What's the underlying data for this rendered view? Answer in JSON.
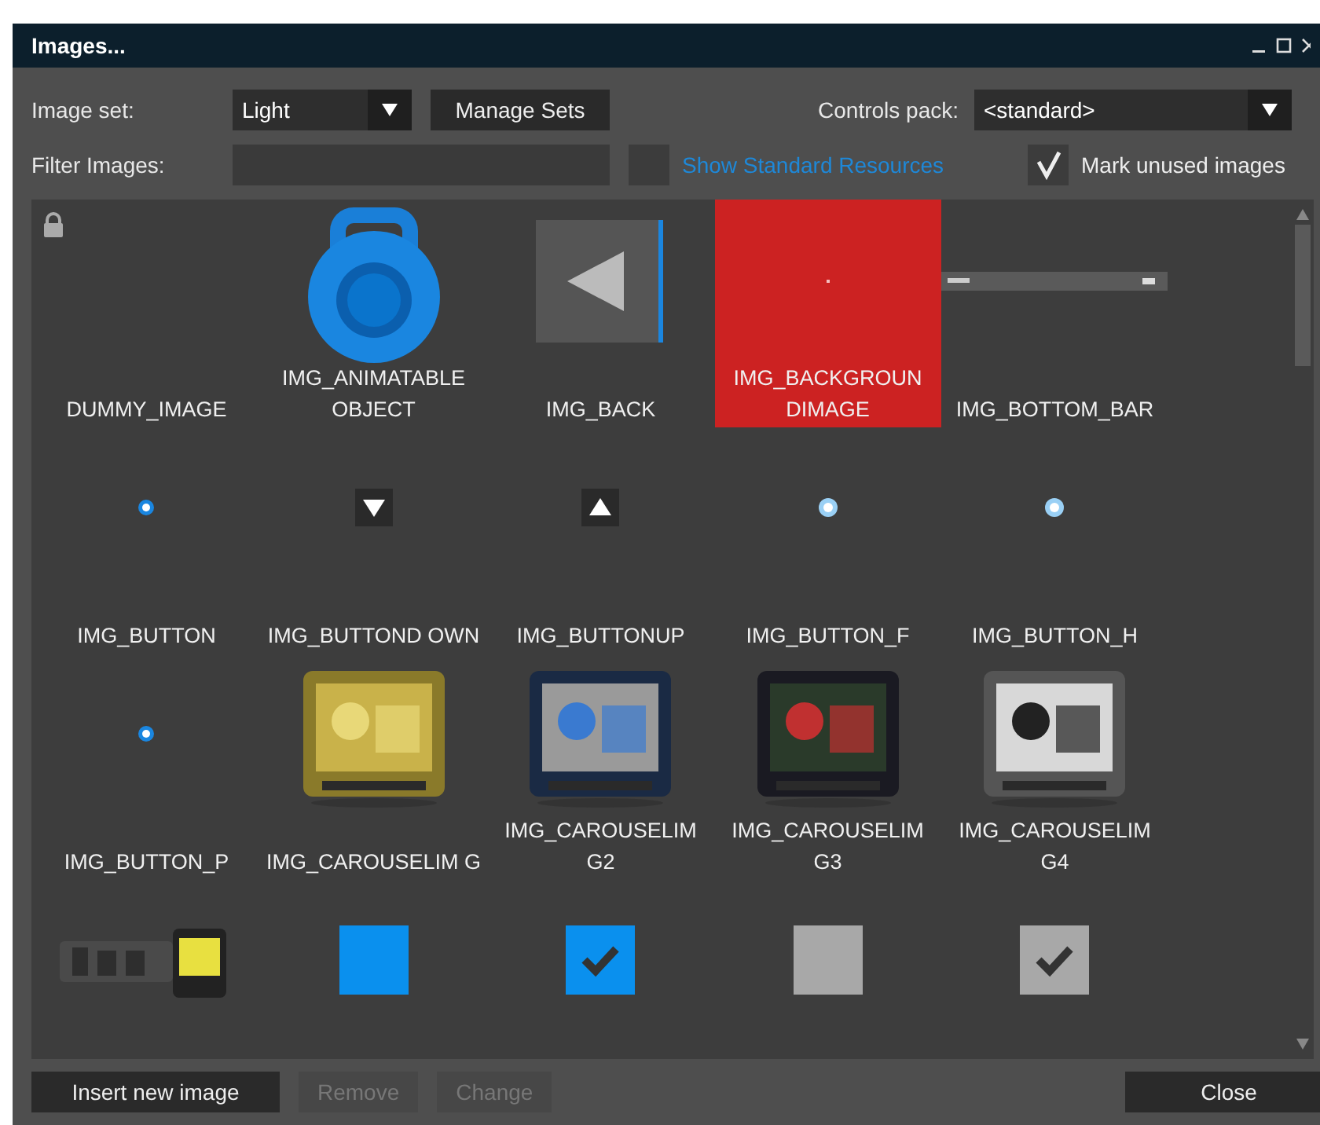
{
  "window": {
    "title": "Images..."
  },
  "image_set": {
    "label": "Image set:",
    "value": "Light"
  },
  "manage_button": "Manage Sets",
  "controls_pack": {
    "label": "Controls pack:",
    "value": "<standard>"
  },
  "filter": {
    "label": "Filter Images:"
  },
  "show_standard": {
    "label": "Show Standard Resources",
    "checked": false
  },
  "mark_unused": {
    "label": "Mark unused images",
    "checked": true
  },
  "items": [
    {
      "label": "DUMMY_IMAGE",
      "kind": "lock",
      "selected": false
    },
    {
      "label": "IMG_ANIMATABLE OBJECT",
      "kind": "kettlebell",
      "selected": false
    },
    {
      "label": "IMG_BACK",
      "kind": "back",
      "selected": false
    },
    {
      "label": "IMG_BACKGROUN DIMAGE",
      "kind": "speck",
      "selected": true
    },
    {
      "label": "IMG_BOTTOM_BAR",
      "kind": "bar",
      "selected": false
    },
    {
      "label": "IMG_BUTTON",
      "kind": "dot",
      "selected": false
    },
    {
      "label": "IMG_BUTTOND OWN",
      "kind": "down",
      "selected": false
    },
    {
      "label": "IMG_BUTTONUP",
      "kind": "up",
      "selected": false
    },
    {
      "label": "IMG_BUTTON_F",
      "kind": "glow",
      "selected": false
    },
    {
      "label": "IMG_BUTTON_H",
      "kind": "glow",
      "selected": false
    },
    {
      "label": "IMG_BUTTON_P",
      "kind": "dot",
      "selected": false
    },
    {
      "label": "IMG_CAROUSELIM G",
      "selected": false
    },
    {
      "label": "IMG_CAROUSELIM G2",
      "selected": false
    },
    {
      "label": "IMG_CAROUSELIM G3",
      "selected": false
    },
    {
      "label": "IMG_CAROUSELIM G4",
      "selected": false
    },
    {
      "kind": "logo",
      "selected": false
    },
    {
      "kind": "checkbox",
      "color": "#0a90ee",
      "checked": false,
      "selected": false
    },
    {
      "kind": "checkbox",
      "color": "#0a90ee",
      "checked": true,
      "selected": false
    },
    {
      "kind": "checkbox",
      "color": "#a8a8a8",
      "checked": false,
      "selected": false
    },
    {
      "kind": "checkbox",
      "color": "#a8a8a8",
      "checked": true,
      "selected": false
    }
  ],
  "buttons": [
    {
      "label": "Insert new image",
      "disabled": false
    },
    {
      "label": "Remove",
      "disabled": true
    },
    {
      "label": "Change",
      "disabled": true
    }
  ],
  "close_button": "Close"
}
